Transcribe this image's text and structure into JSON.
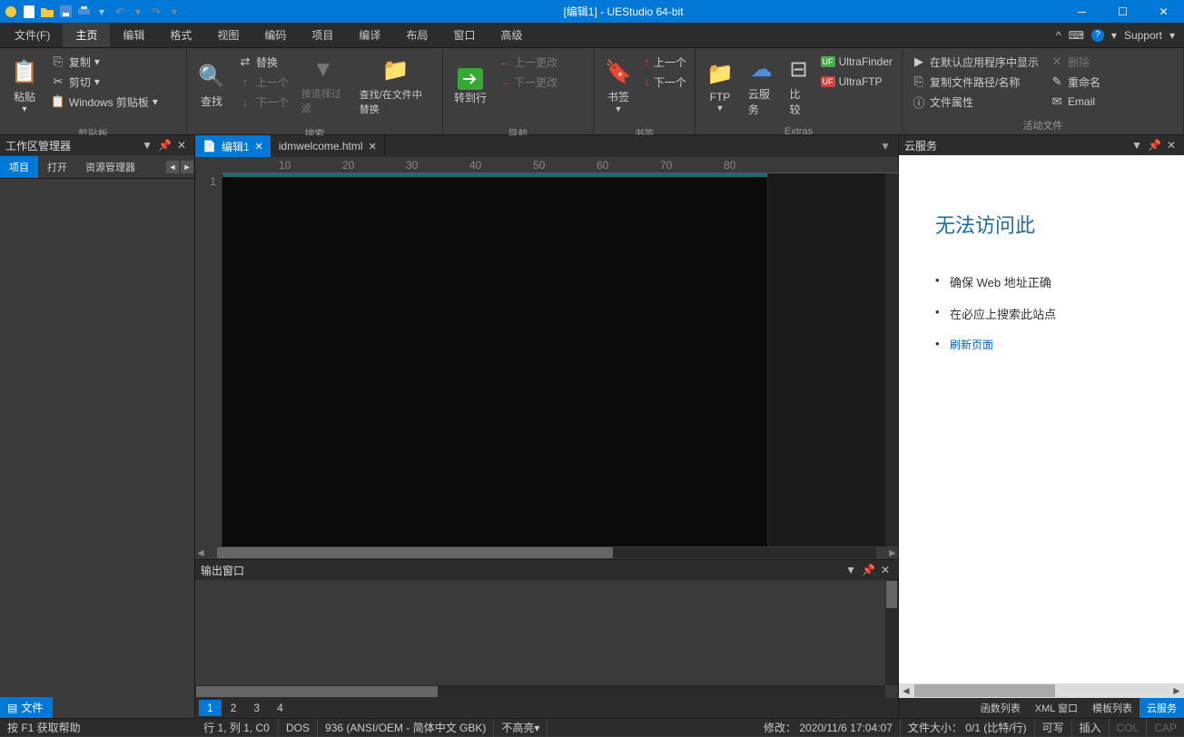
{
  "title": "[编辑1] - UEStudio 64-bit",
  "menu": {
    "file": "文件(F)",
    "items": [
      "主页",
      "编辑",
      "格式",
      "视图",
      "编码",
      "项目",
      "编译",
      "布局",
      "窗口",
      "高级"
    ],
    "active": 0,
    "support": "Support"
  },
  "ribbon": {
    "clipboard": {
      "label": "剪贴板",
      "paste": "粘贴",
      "copy": "复制",
      "cut": "剪切",
      "win": "Windows 剪贴板"
    },
    "search": {
      "label": "搜索",
      "find": "查找",
      "replace": "替换",
      "prev": "上一个",
      "next": "下一个",
      "filter": "按选择过滤",
      "infiles": "查找/在文件中替换"
    },
    "nav": {
      "label": "导航",
      "goto": "转到行",
      "prevchg": "上一更改",
      "nextchg": "下一更改"
    },
    "bookmark": {
      "label": "书签",
      "bm": "书签",
      "prev": "上一个",
      "next": "下一个"
    },
    "extras": {
      "label": "Extras",
      "ftp": "FTP",
      "cloud": "云服务",
      "compare": "比较",
      "uf": "UltraFinder",
      "uftp": "UltraFTP"
    },
    "active": {
      "label": "活动文件",
      "defapp": "在默认应用程序中显示",
      "copypath": "复制文件路径/名称",
      "props": "文件属性",
      "del": "删除",
      "rename": "重命名",
      "email": "Email"
    }
  },
  "left": {
    "title": "工作区管理器",
    "tabs": [
      "项目",
      "打开",
      "资源管理器"
    ],
    "active": 0,
    "foot": "文件"
  },
  "editor": {
    "tabs": [
      {
        "name": "编辑1",
        "active": true
      },
      {
        "name": "idmwelcome.html",
        "active": false
      }
    ],
    "line": "1",
    "ruler": [
      "10",
      "20",
      "30",
      "40",
      "50",
      "60",
      "70",
      "80"
    ]
  },
  "output": {
    "title": "输出窗口",
    "pages": [
      "1",
      "2",
      "3",
      "4"
    ],
    "active": 0
  },
  "cloud": {
    "title": "云服务",
    "heading": "无法访问此",
    "li1": "确保 Web 地址正确",
    "li2": "在必应上搜索此站点",
    "li3": "刷新页面",
    "tabs": [
      "函数列表",
      "XML 窗口",
      "模板列表",
      "云服务"
    ],
    "active": 3
  },
  "status": {
    "help": "按 F1 获取帮助",
    "pos": "行 1, 列 1, C0",
    "enc": "DOS",
    "cp": "936  (ANSI/OEM - 简体中文 GBK)",
    "hl": "不高亮",
    "mod": "修改：",
    "dt": "2020/11/6 17:04:07",
    "sz": "文件大小：",
    "szv": "0/1  (比特/行)",
    "rw": "可写",
    "ins": "插入",
    "col": "COL",
    "cap": "CAP"
  }
}
